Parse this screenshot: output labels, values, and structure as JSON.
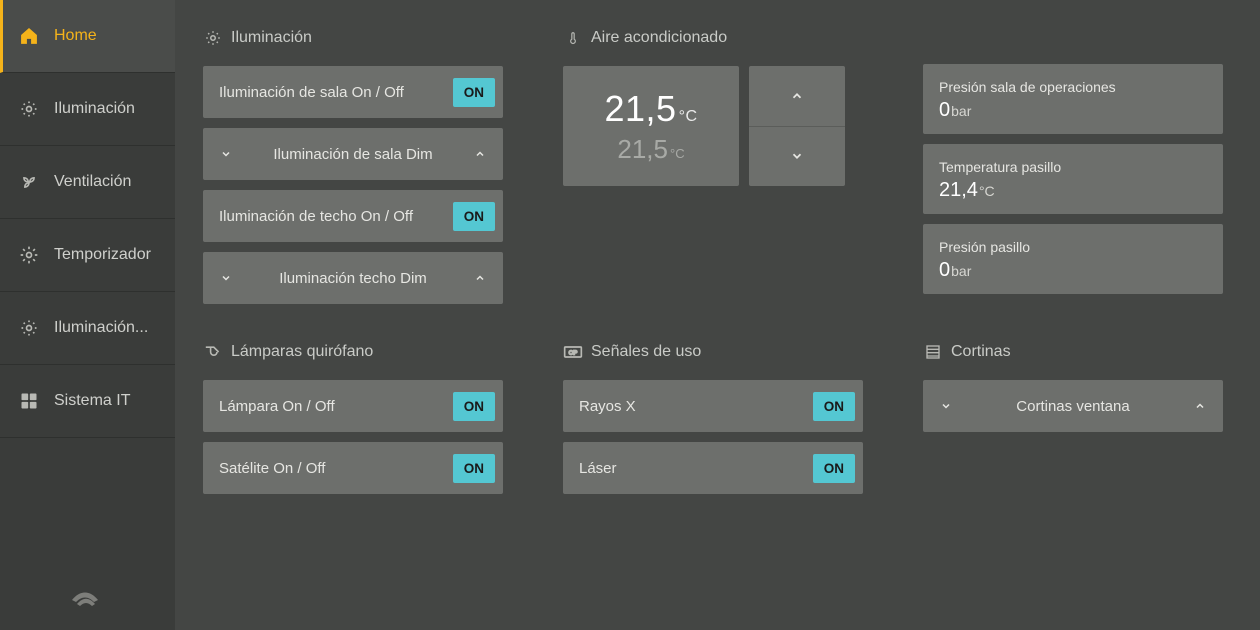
{
  "sidebar": {
    "items": [
      {
        "label": "Home"
      },
      {
        "label": "Iluminación"
      },
      {
        "label": "Ventilación"
      },
      {
        "label": "Temporizador"
      },
      {
        "label": "Iluminación..."
      },
      {
        "label": "Sistema IT"
      }
    ]
  },
  "sections": {
    "lighting": {
      "title": "Iluminación",
      "room_onoff": {
        "label": "Iluminación de sala On / Off",
        "state": "ON"
      },
      "room_dim": {
        "label": "Iluminación de sala Dim"
      },
      "ceiling_onoff": {
        "label": "Iluminación de techo On / Off",
        "state": "ON"
      },
      "ceiling_dim": {
        "label": "Iluminación techo Dim"
      }
    },
    "ac": {
      "title": "Aire acondicionado",
      "setpoint": "21,5",
      "setpoint_unit": "°C",
      "current": "21,5",
      "current_unit": "°C"
    },
    "stats": {
      "op_pressure": {
        "label": "Presión sala de operaciones",
        "value": "0",
        "unit": "bar"
      },
      "hall_temp": {
        "label": "Temperatura pasillo",
        "value": "21,4",
        "unit": "°C"
      },
      "hall_pressure": {
        "label": "Presión pasillo",
        "value": "0",
        "unit": "bar"
      }
    },
    "surgical": {
      "title": "Lámparas quirófano",
      "lamp": {
        "label": "Lámpara On / Off",
        "state": "ON"
      },
      "satellite": {
        "label": "Satélite On / Off",
        "state": "ON"
      }
    },
    "signals": {
      "title": "Señales de uso",
      "xray": {
        "label": "Rayos X",
        "state": "ON"
      },
      "laser": {
        "label": "Láser",
        "state": "ON"
      }
    },
    "curtains": {
      "title": "Cortinas",
      "window": {
        "label": "Cortinas ventana"
      }
    }
  }
}
